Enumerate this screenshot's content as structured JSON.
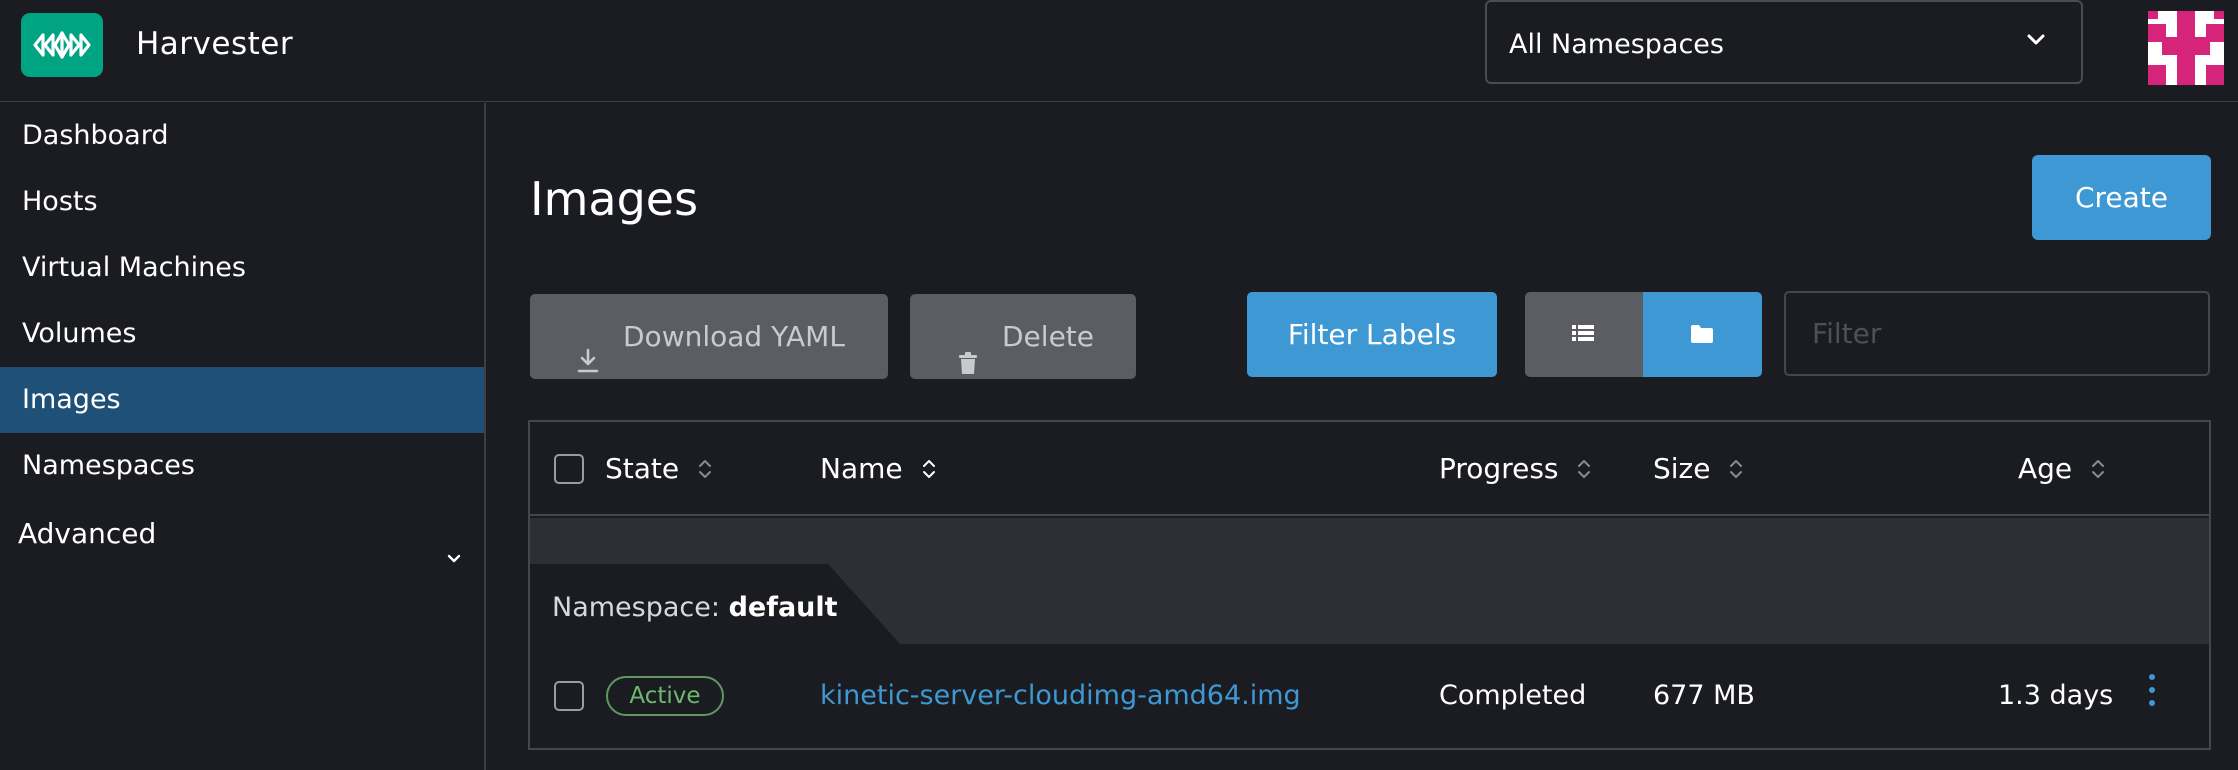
{
  "header": {
    "app_title": "Harvester",
    "namespace_select": {
      "value": "All Namespaces"
    }
  },
  "sidebar": {
    "items": [
      {
        "label": "Dashboard",
        "active": false
      },
      {
        "label": "Hosts",
        "active": false
      },
      {
        "label": "Virtual Machines",
        "active": false
      },
      {
        "label": "Volumes",
        "active": false
      },
      {
        "label": "Images",
        "active": true
      },
      {
        "label": "Namespaces",
        "active": false
      },
      {
        "label": "Advanced",
        "active": false,
        "expandable": true
      }
    ]
  },
  "main": {
    "title": "Images",
    "create_label": "Create",
    "toolbar": {
      "download_yaml_label": "Download YAML",
      "delete_label": "Delete",
      "filter_labels_label": "Filter Labels",
      "view_mode": "folder",
      "filter_placeholder": "Filter",
      "filter_value": ""
    },
    "table": {
      "columns": [
        "State",
        "Name",
        "Progress",
        "Size",
        "Age"
      ],
      "group": {
        "prefix": "Namespace:",
        "name": "default"
      },
      "rows": [
        {
          "state": "Active",
          "name": "kinetic-server-cloudimg-amd64.img",
          "progress": "Completed",
          "size": "677 MB",
          "age": "1.3 days"
        }
      ]
    }
  },
  "colors": {
    "background": "#1b1c21",
    "accent": "#3d98d3",
    "active_nav": "#1f5078",
    "logo": "#00a483",
    "avatar": "#d6247a",
    "badge_active": "#6fb86f",
    "disabled_button": "#5c5d62"
  },
  "icons": {
    "logo": "harvester-logo-icon",
    "namespace_chevron": "chevron-down-icon",
    "download": "download-icon",
    "delete": "trash-icon",
    "list_view": "list-icon",
    "folder_view": "folder-icon",
    "sort": "sort-icon",
    "row_actions": "more-vertical-icon"
  }
}
